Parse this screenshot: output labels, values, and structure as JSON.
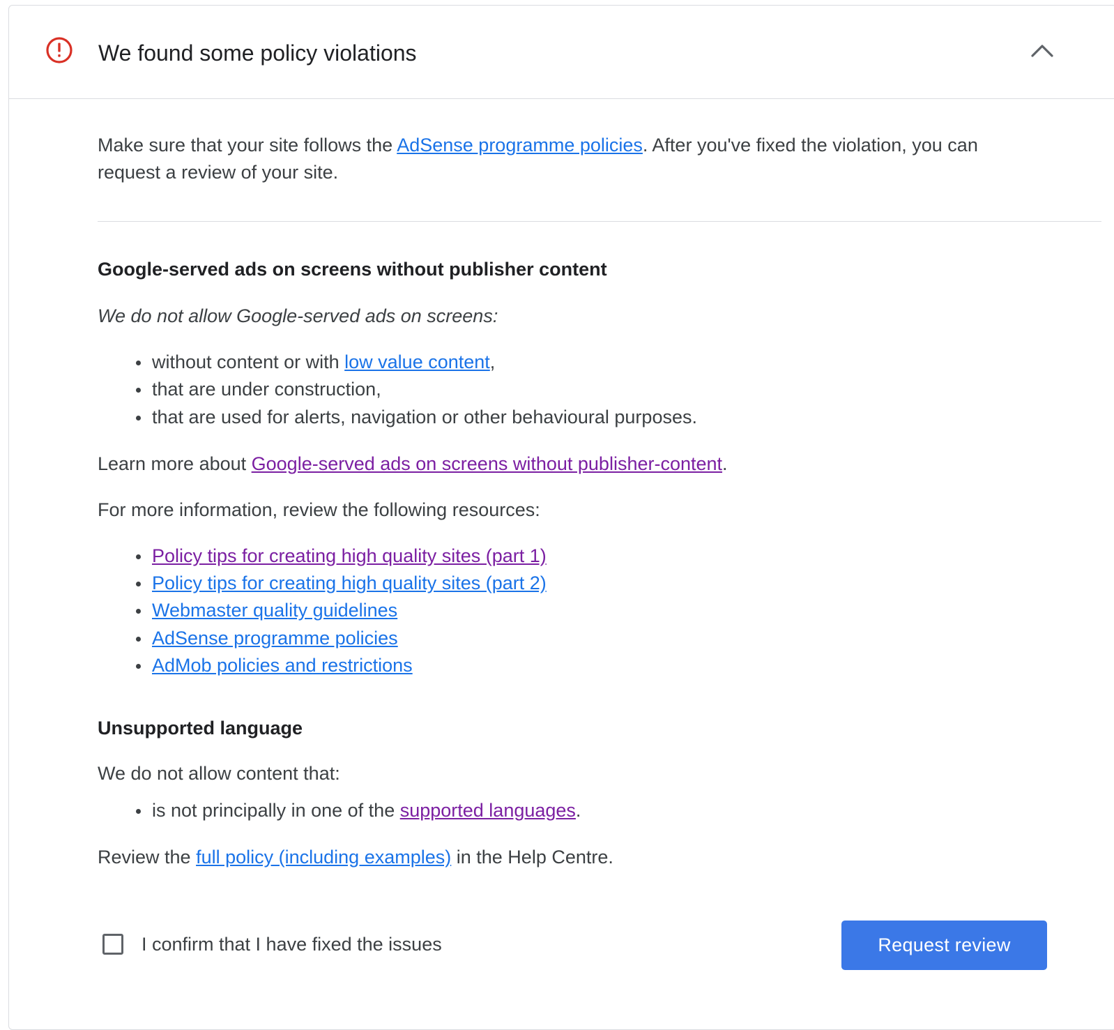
{
  "header": {
    "title": "We found some policy violations",
    "status_icon": "error-icon",
    "collapse_icon": "chevron-up-icon",
    "error_color": "#d93025"
  },
  "intro": {
    "text_before": "Make sure that your site follows the ",
    "link": "AdSense programme policies",
    "text_after": ". After you've fixed the violation, you can request a review of your site."
  },
  "violations": [
    {
      "title": "Google-served ads on screens without publisher content",
      "lead": "We do not allow Google-served ads on screens:",
      "bullets": [
        {
          "text_before": "without content or with ",
          "link": "low value content",
          "text_after": ","
        },
        {
          "text": "that are under construction,"
        },
        {
          "text": "that are used for alerts, navigation or other behavioural purposes."
        }
      ],
      "learn_more": {
        "text_before": "Learn more about ",
        "link": "Google-served ads on screens without publisher-content",
        "text_after": "."
      },
      "resources_intro": "For more information, review the following resources:",
      "resources": [
        "Policy tips for creating high quality sites (part 1)",
        "Policy tips for creating high quality sites (part 2)",
        "Webmaster quality guidelines",
        "AdSense programme policies",
        "AdMob policies and restrictions"
      ]
    },
    {
      "title": "Unsupported language",
      "lead": "We do not allow content that:",
      "bullets": [
        {
          "text_before": "is not principally in one of the ",
          "link": "supported languages",
          "text_after": "."
        }
      ],
      "review": {
        "text_before": "Review the ",
        "link": "full policy (including examples)",
        "text_after": " in the Help Centre."
      }
    }
  ],
  "footer": {
    "checkbox_label": "I confirm that I have fixed the issues",
    "checkbox_checked": false,
    "button_label": "Request review"
  },
  "colors": {
    "link": "#1a73e8",
    "visited_link": "#7b1fa2",
    "primary_button": "#3b78e7"
  }
}
